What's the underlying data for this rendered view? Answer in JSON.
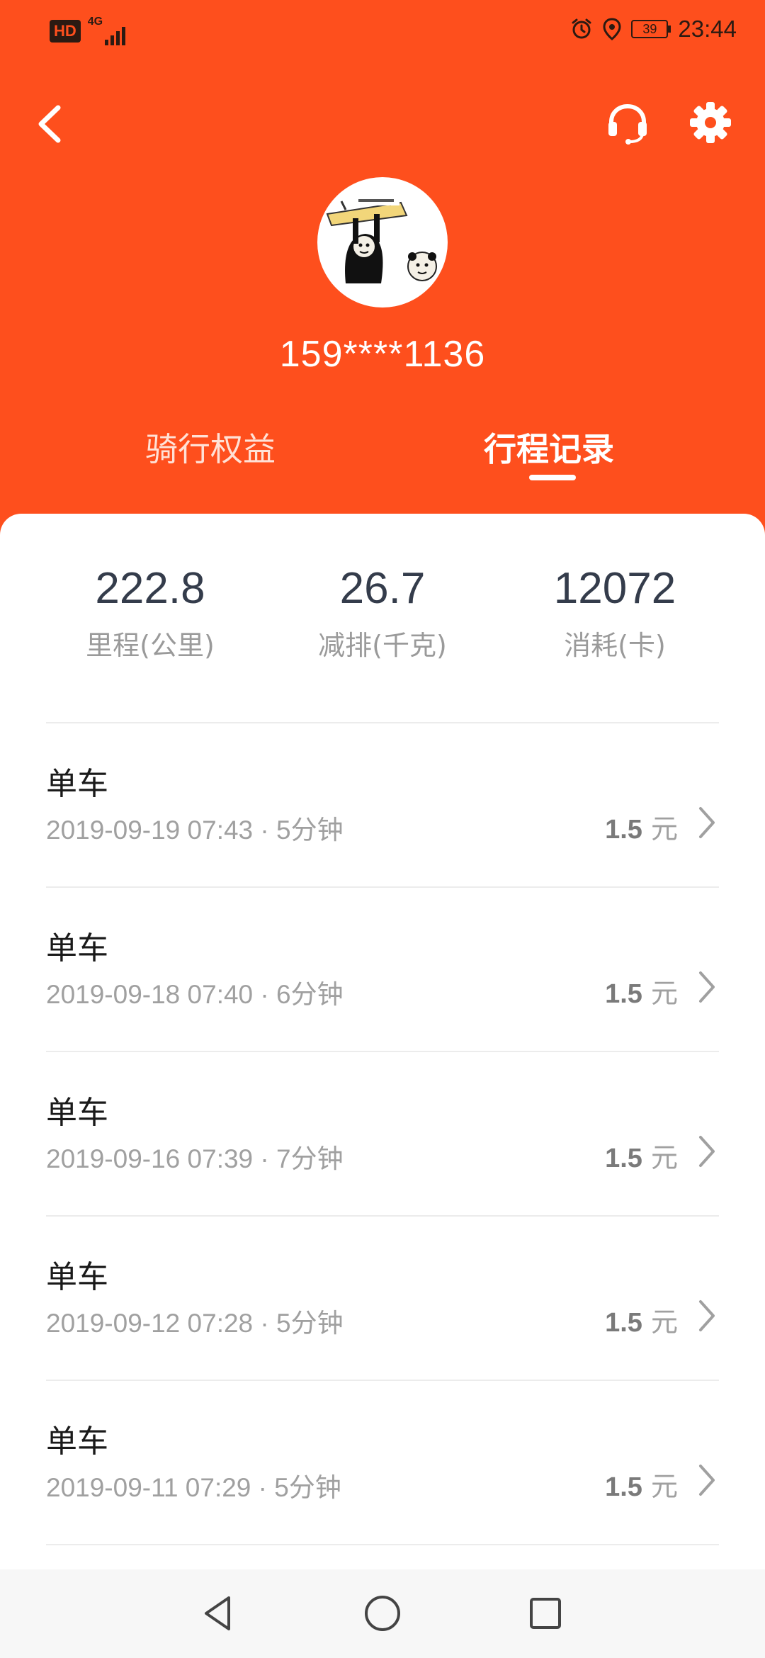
{
  "status_bar": {
    "hd_badge": "HD",
    "network": "4G",
    "battery": "39",
    "time": "23:44",
    "icons": [
      "alarm-icon",
      "location-icon",
      "battery-icon",
      "signal-icon"
    ]
  },
  "header": {
    "phone": "159****1136",
    "tabs": [
      {
        "label": "骑行权益",
        "active": false
      },
      {
        "label": "行程记录",
        "active": true
      }
    ],
    "background_color": "#fe4f1d"
  },
  "stats": [
    {
      "value": "222.8",
      "label": "里程(公里)"
    },
    {
      "value": "26.7",
      "label": "减排(千克)"
    },
    {
      "value": "12072",
      "label": "消耗(卡)"
    }
  ],
  "trips": [
    {
      "title": "单车",
      "subtitle": "2019-09-19 07:43 · 5分钟",
      "price": "1.5",
      "unit": " 元"
    },
    {
      "title": "单车",
      "subtitle": "2019-09-18 07:40 · 6分钟",
      "price": "1.5",
      "unit": " 元"
    },
    {
      "title": "单车",
      "subtitle": "2019-09-16 07:39 · 7分钟",
      "price": "1.5",
      "unit": " 元"
    },
    {
      "title": "单车",
      "subtitle": "2019-09-12 07:28 · 5分钟",
      "price": "1.5",
      "unit": " 元"
    },
    {
      "title": "单车",
      "subtitle": "2019-09-11 07:29 · 5分钟",
      "price": "1.5",
      "unit": " 元"
    }
  ]
}
